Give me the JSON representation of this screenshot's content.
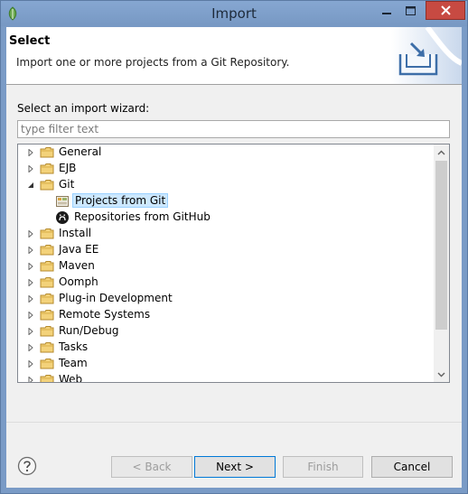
{
  "window": {
    "title": "Import",
    "accent": "#7a9bc6",
    "close_color": "#c74a42"
  },
  "banner": {
    "title": "Select",
    "description": "Import one or more projects from a Git Repository."
  },
  "wizard": {
    "label": "Select an import wizard:",
    "filter_placeholder": "type filter text",
    "filter_value": ""
  },
  "tree": {
    "items": [
      {
        "label": "General",
        "icon": "folder-icon",
        "expanded": false
      },
      {
        "label": "EJB",
        "icon": "folder-icon",
        "expanded": false
      },
      {
        "label": "Git",
        "icon": "folder-icon",
        "expanded": true
      },
      {
        "label": "Projects from Git",
        "icon": "git-projects-icon",
        "child": true,
        "selected": true
      },
      {
        "label": "Repositories from GitHub",
        "icon": "github-icon",
        "child": true
      },
      {
        "label": "Install",
        "icon": "folder-icon",
        "expanded": false
      },
      {
        "label": "Java EE",
        "icon": "folder-icon",
        "expanded": false
      },
      {
        "label": "Maven",
        "icon": "folder-icon",
        "expanded": false
      },
      {
        "label": "Oomph",
        "icon": "folder-icon",
        "expanded": false
      },
      {
        "label": "Plug-in Development",
        "icon": "folder-icon",
        "expanded": false
      },
      {
        "label": "Remote Systems",
        "icon": "folder-icon",
        "expanded": false
      },
      {
        "label": "Run/Debug",
        "icon": "folder-icon",
        "expanded": false
      },
      {
        "label": "Tasks",
        "icon": "folder-icon",
        "expanded": false
      },
      {
        "label": "Team",
        "icon": "folder-icon",
        "expanded": false
      },
      {
        "label": "Web",
        "icon": "folder-icon",
        "expanded": false
      }
    ]
  },
  "buttons": {
    "back": "< Back",
    "next": "Next >",
    "finish": "Finish",
    "cancel": "Cancel"
  }
}
